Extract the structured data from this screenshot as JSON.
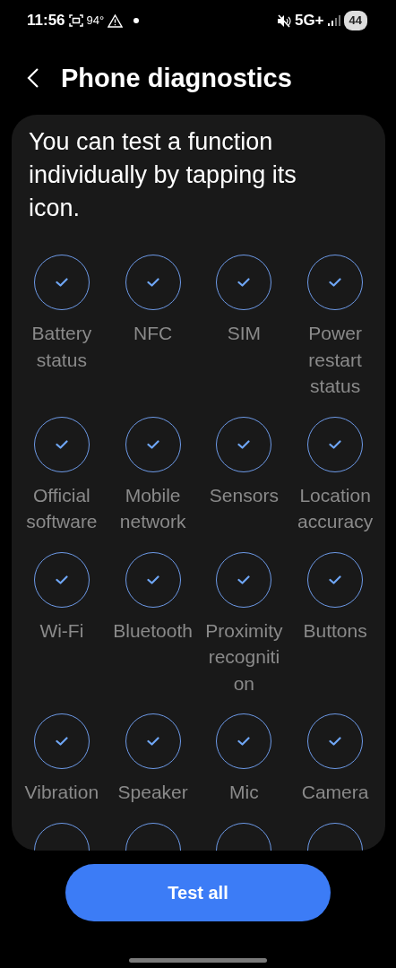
{
  "status_bar": {
    "time": "11:56",
    "temperature": "94°",
    "network": "5G+",
    "battery": "44"
  },
  "header": {
    "title": "Phone diagnostics"
  },
  "intro": "You can test a function individually by tapping its icon.",
  "tests": [
    {
      "label": "Battery status",
      "checked": true
    },
    {
      "label": "NFC",
      "checked": true
    },
    {
      "label": "SIM",
      "checked": true
    },
    {
      "label": "Power restart status",
      "checked": true
    },
    {
      "label": "Official software",
      "checked": true
    },
    {
      "label": "Mobile network",
      "checked": true
    },
    {
      "label": "Sensors",
      "checked": true
    },
    {
      "label": "Location accuracy",
      "checked": true
    },
    {
      "label": "Wi-Fi",
      "checked": true
    },
    {
      "label": "Bluetooth",
      "checked": true
    },
    {
      "label": "Proximity recogniti on",
      "checked": true
    },
    {
      "label": "Buttons",
      "checked": true
    },
    {
      "label": "Vibration",
      "checked": true
    },
    {
      "label": "Speaker",
      "checked": true
    },
    {
      "label": "Mic",
      "checked": true
    },
    {
      "label": "Camera",
      "checked": true
    },
    {
      "checked": false
    },
    {
      "checked": false
    },
    {
      "checked": false
    },
    {
      "checked": false
    }
  ],
  "button": {
    "label": "Test all"
  }
}
